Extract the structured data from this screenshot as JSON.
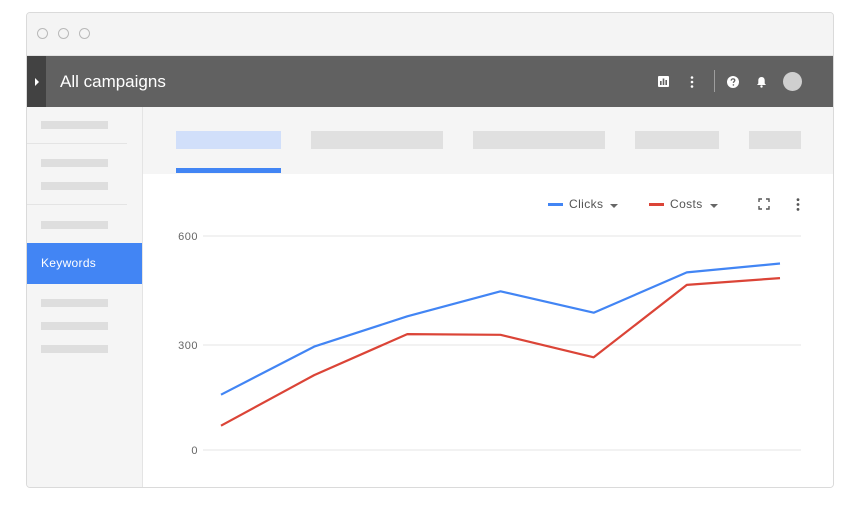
{
  "window": {
    "controls": [
      "close",
      "minimize",
      "maximize"
    ]
  },
  "appbar": {
    "title": "All campaigns",
    "icons": [
      "menu-expand-icon",
      "bar-chart-icon",
      "more-vert-icon",
      "help-icon",
      "notifications-icon",
      "avatar"
    ]
  },
  "sidebar": {
    "active_item_label": "Keywords"
  },
  "colors": {
    "appbar": "#616161",
    "accent": "#4285f4",
    "clicks": "#4285f4",
    "costs": "#db4437"
  },
  "chart": {
    "legend": [
      {
        "label": "Clicks",
        "color": "#4285f4"
      },
      {
        "label": "Costs",
        "color": "#db4437"
      }
    ]
  },
  "chart_data": {
    "type": "line",
    "x": [
      1,
      2,
      3,
      4,
      5,
      6,
      7
    ],
    "yticks": [
      "600",
      "300",
      "0"
    ],
    "ylim": [
      0,
      600
    ],
    "grid": true,
    "legend_position": "top-right",
    "series": [
      {
        "name": "Clicks",
        "color": "#4285f4",
        "values": [
          155,
          290,
          375,
          445,
          385,
          498,
          523
        ]
      },
      {
        "name": "Costs",
        "color": "#db4437",
        "values": [
          68,
          210,
          325,
          323,
          260,
          463,
          482
        ]
      }
    ]
  }
}
